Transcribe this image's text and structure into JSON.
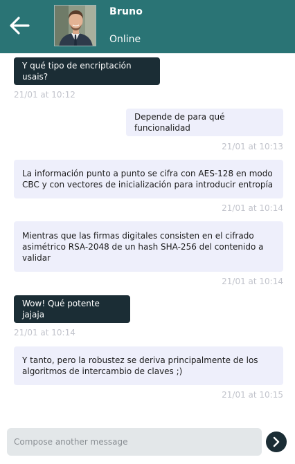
{
  "header": {
    "back_icon": "arrow-left-icon",
    "contact_name": "Bruno",
    "status": "Online",
    "colors": {
      "header_bg": "#2a7475"
    }
  },
  "messages": [
    {
      "side": "received",
      "text": "Y qué tipo de encriptación usais?",
      "time": "21/01 at 10:12"
    },
    {
      "side": "sent",
      "text": "Depende de para qué funcionalidad",
      "time": "21/01 at 10:13"
    },
    {
      "side": "sent",
      "text": "La información punto a punto se cifra con AES-128 en modo CBC y con vectores de inicialización para introducir entropía",
      "time": "21/01 at 10:14"
    },
    {
      "side": "sent",
      "text": "Mientras que las firmas digitales consisten en el cifrado asimétrico RSA-2048 de un hash SHA-256 del contenido a validar",
      "time": "21/01 at 10:14"
    },
    {
      "side": "received",
      "text": "Wow! Qué potente jajaja",
      "time": "21/01 at 10:14"
    },
    {
      "side": "sent",
      "text": "Y tanto, pero la robustez se deriva principalmente de los algoritmos de intercambio de claves ;)",
      "time": "21/01 at 10:15"
    }
  ],
  "composer": {
    "placeholder": "Compose another message",
    "send_icon": "chevron-right-icon"
  },
  "colors": {
    "received_bubble": "#1b2d35",
    "sent_bubble": "#eeeffb",
    "timestamp": "#c2c4cc"
  }
}
